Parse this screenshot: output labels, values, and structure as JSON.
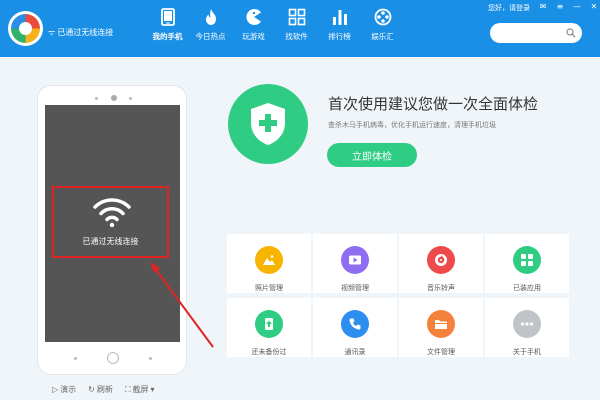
{
  "header": {
    "connection_status": "已通过无线连接",
    "user_link": "您好，请登录",
    "nav": [
      {
        "label": "我的手机",
        "icon": "phone-icon"
      },
      {
        "label": "今日热点",
        "icon": "fire-icon"
      },
      {
        "label": "玩游戏",
        "icon": "pacman-icon"
      },
      {
        "label": "找软件",
        "icon": "apps-grid-icon"
      },
      {
        "label": "排行榜",
        "icon": "bar-chart-icon"
      },
      {
        "label": "娱乐汇",
        "icon": "film-reel-icon"
      }
    ],
    "search": {
      "value": "",
      "placeholder": ""
    }
  },
  "phone": {
    "wifi_status_text": "已通过无线连接",
    "actions": [
      {
        "label": "演示",
        "icon": "play-icon"
      },
      {
        "label": "刷新",
        "icon": "refresh-icon"
      },
      {
        "label": "截屏",
        "icon": "crop-icon"
      }
    ]
  },
  "check": {
    "title": "首次使用建议您做一次全面体检",
    "subtitle": "查杀木马手机病毒，优化手机运行速度，清理手机垃圾",
    "button_label": "立即体检",
    "icon": "shield-plus-icon"
  },
  "tools": [
    {
      "label": "照片管理",
      "icon": "photo-icon",
      "color": "#f7b500"
    },
    {
      "label": "视频管理",
      "icon": "video-icon",
      "color": "#8f6df2"
    },
    {
      "label": "音乐铃声",
      "icon": "music-icon",
      "color": "#ef4a4a"
    },
    {
      "label": "已装应用",
      "icon": "apps-icon",
      "color": "#2fcc83"
    },
    {
      "label": "还未备份过",
      "icon": "backup-icon",
      "color": "#2fcc83"
    },
    {
      "label": "通讯录",
      "icon": "contacts-icon",
      "color": "#2e8ef0"
    },
    {
      "label": "文件管理",
      "icon": "folder-icon",
      "color": "#f5823a"
    },
    {
      "label": "关于手机",
      "icon": "more-icon",
      "color": "#c0c4c8"
    }
  ],
  "colors": {
    "header_bg": "#1a8fe6",
    "accent_green": "#2fcc83",
    "alert_red": "#e02424"
  }
}
